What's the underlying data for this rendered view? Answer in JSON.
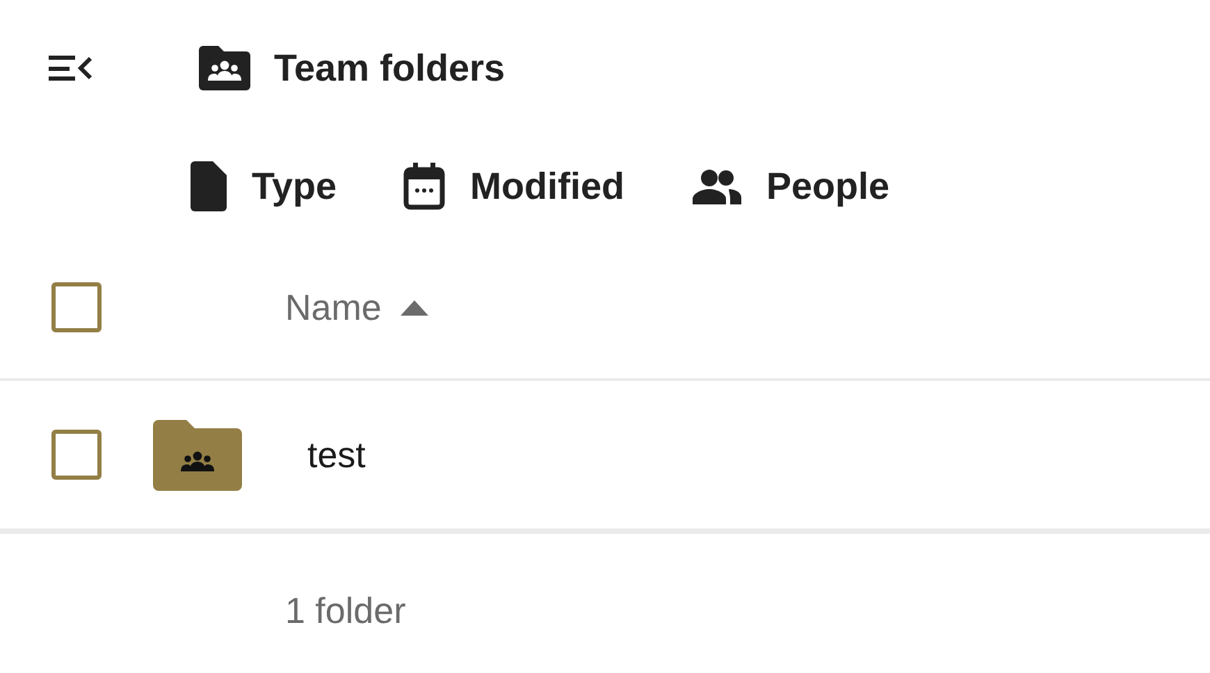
{
  "header": {
    "title": "Team folders"
  },
  "filters": [
    {
      "kind": "type",
      "label": "Type"
    },
    {
      "kind": "modified",
      "label": "Modified"
    },
    {
      "kind": "people",
      "label": "People"
    }
  ],
  "table": {
    "select_all": {
      "checked": false
    },
    "columns": [
      {
        "label": "Name",
        "sort_ascending": true
      }
    ],
    "rows": [
      {
        "name": "test",
        "checked": false
      }
    ]
  },
  "footer": "1 folder"
}
